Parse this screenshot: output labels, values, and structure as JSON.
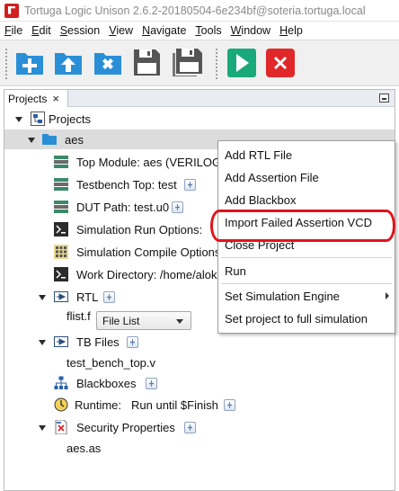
{
  "window": {
    "title": "Tortuga Logic Unison 2.6.2-20180504-6e234bf@soteria.tortuga.local"
  },
  "menubar": {
    "items": [
      {
        "label": "File",
        "u": 0
      },
      {
        "label": "Edit",
        "u": 0
      },
      {
        "label": "Session",
        "u": 0
      },
      {
        "label": "View",
        "u": 0
      },
      {
        "label": "Navigate",
        "u": 0
      },
      {
        "label": "Tools",
        "u": 0
      },
      {
        "label": "Window",
        "u": 0
      },
      {
        "label": "Help",
        "u": 0
      }
    ]
  },
  "toolbar": {
    "buttons": [
      {
        "name": "new-project-icon",
        "color": "#2a8fd6"
      },
      {
        "name": "open-project-icon",
        "color": "#2a8fd6"
      },
      {
        "name": "close-project-icon",
        "color": "#2a8fd6"
      },
      {
        "name": "save-icon",
        "color": "#555555"
      },
      {
        "name": "save-all-icon",
        "color": "#555555"
      },
      {
        "name": "run-icon",
        "color": "#1aa97b"
      },
      {
        "name": "stop-icon",
        "color": "#e0282a"
      }
    ]
  },
  "panel": {
    "tab_label": "Projects",
    "tab_close": "×"
  },
  "tree": {
    "root_label": "Projects",
    "project_label": "aes",
    "top_module": "Top Module: aes (VERILOG",
    "testbench_top": "Testbench Top: test",
    "dut_path": "DUT Path: test.u0",
    "sim_run_options": "Simulation Run Options:",
    "sim_compile_options": "Simulation Compile Options",
    "work_directory": "Work Directory: /home/alok",
    "rtl_label": "RTL",
    "rtl_file": "flist.f",
    "rtl_file_type": "File List",
    "tb_files_label": "TB Files",
    "tb_file": "test_bench_top.v",
    "blackboxes_label": "Blackboxes",
    "runtime_label": "Runtime:",
    "runtime_value": "Run until $Finish",
    "security_label": "Security Properties",
    "security_file": "aes.as"
  },
  "context_menu": {
    "items": [
      "Add RTL File",
      "Add Assertion File",
      "Add Blackbox",
      "Import Failed Assertion VCD",
      "Close Project",
      "Run",
      "Set Simulation Engine",
      "Set project to full simulation"
    ]
  },
  "colors": {
    "annotation": "#e3121a",
    "folder": "#2a8fd6"
  }
}
